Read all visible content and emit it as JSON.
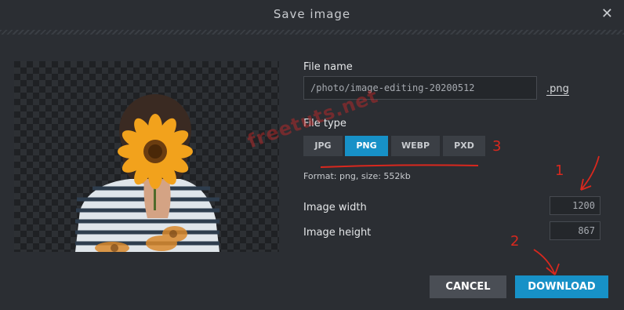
{
  "dialog": {
    "title": "Save image",
    "close_glyph": "✕"
  },
  "file_name": {
    "label": "File name",
    "value": "/photo/image-editing-20200512",
    "extension": ".png"
  },
  "file_type": {
    "label": "File type",
    "options": [
      "JPG",
      "PNG",
      "WEBP",
      "PXD"
    ],
    "selected": "PNG"
  },
  "format_info": "Format: png, size: 552kb",
  "image_width": {
    "label": "Image width",
    "value": "1200"
  },
  "image_height": {
    "label": "Image height",
    "value": "867"
  },
  "buttons": {
    "cancel": "CANCEL",
    "download": "DOWNLOAD"
  },
  "annotations": {
    "step1": "1",
    "step2": "2",
    "step3": "3",
    "watermark": "freetuts.net"
  },
  "colors": {
    "accent": "#1791c7",
    "background": "#2b2e33",
    "annotation": "#d9281e"
  }
}
